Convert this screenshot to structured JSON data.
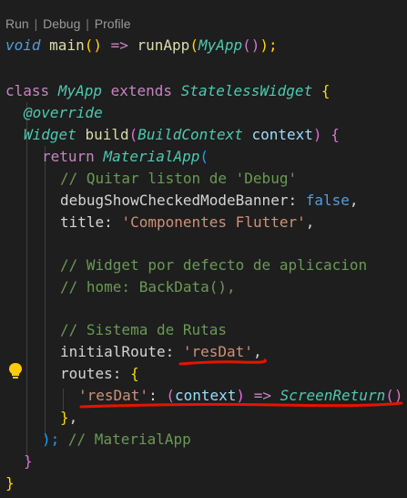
{
  "codelens": {
    "run": "Run",
    "debug": "Debug",
    "profile": "Profile"
  },
  "code": {
    "l1": {
      "void": "void",
      "main": "main",
      "open": "() ",
      "arrow": "=>",
      "runApp": "runApp",
      "p1": "(",
      "myapp": "MyApp",
      "p2": "()",
      "p3": ");"
    },
    "l3": {
      "class": "class",
      "name": "MyApp",
      "extends": "extends",
      "super": "StatelessWidget",
      "brace": "{"
    },
    "l4": {
      "override": "@override"
    },
    "l5": {
      "type": "Widget",
      "build": "build",
      "p1": "(",
      "ptype": "BuildContext",
      "pname": "context",
      "p2": ")",
      "brace": "{"
    },
    "l6": {
      "ret": "return",
      "ctor": "MaterialApp",
      "p": "("
    },
    "l7": {
      "comment": "// Quitar liston de 'Debug'"
    },
    "l8": {
      "prop": "debugShowCheckedModeBanner",
      "colon": ":",
      "val": "false",
      "comma": ","
    },
    "l9": {
      "prop": "title",
      "colon": ":",
      "val": "'Componentes Flutter'",
      "comma": ","
    },
    "l11": {
      "comment": "// Widget por defecto de aplicacion"
    },
    "l12": {
      "comment": "// home: BackData(),"
    },
    "l14": {
      "comment": "// Sistema de Rutas"
    },
    "l15": {
      "prop": "initialRoute",
      "colon": ":",
      "val": "'resDat'",
      "comma": ","
    },
    "l16": {
      "prop": "routes",
      "colon": ":",
      "brace": "{"
    },
    "l17": {
      "key": "'resDat'",
      "colon": ":",
      "p1": "(",
      "param": "context",
      "p2": ")",
      "arrow": "=>",
      "ctor": "ScreenReturn",
      "p3": "()"
    },
    "l18": {
      "brace": "}",
      "comma": ","
    },
    "l19": {
      "close": ");",
      "comment": "// MaterialApp"
    },
    "l20": {
      "brace": "}"
    },
    "l21": {
      "brace": "}"
    }
  },
  "colors": {
    "background": "#1e1e1e",
    "underline": "#e51400",
    "bulb": "#ffcc00"
  },
  "icons": {
    "lightbulb": "lightbulb-icon"
  }
}
